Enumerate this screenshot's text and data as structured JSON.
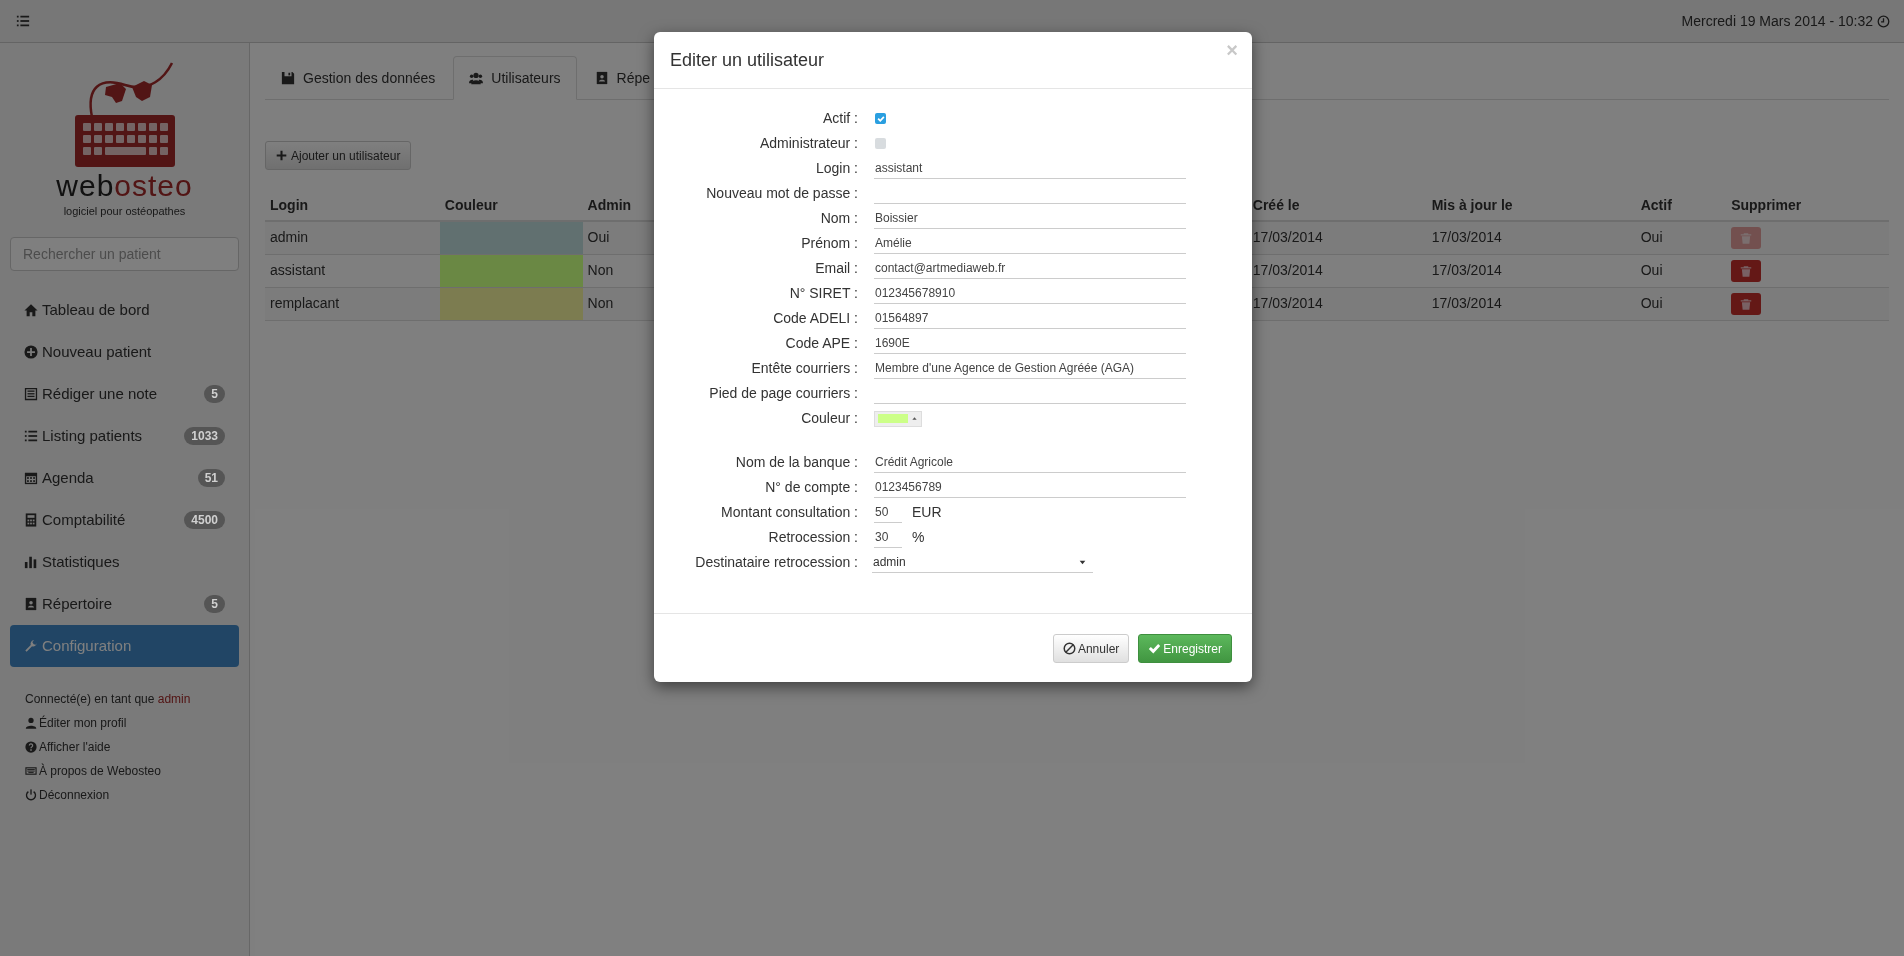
{
  "header": {
    "datetime": "Mercredi 19 Mars 2014 - 10:32"
  },
  "sidebar": {
    "brand": {
      "first": "web",
      "second": "osteo"
    },
    "tagline": "logiciel pour ostéopathes",
    "search": {
      "placeholder": "Rechercher un patient"
    },
    "items": [
      {
        "label": "Tableau de bord",
        "selected": false
      },
      {
        "label": "Nouveau patient",
        "selected": false
      },
      {
        "label": "Rédiger une note",
        "badge": "5",
        "selected": false
      },
      {
        "label": "Listing patients",
        "badge": "1033",
        "selected": false
      },
      {
        "label": "Agenda",
        "badge": "51",
        "selected": false
      },
      {
        "label": "Comptabilité",
        "badge": "4500",
        "selected": false
      },
      {
        "label": "Statistiques",
        "selected": false
      },
      {
        "label": "Répertoire",
        "badge": "5",
        "selected": false
      },
      {
        "label": "Configuration",
        "selected": true
      }
    ],
    "footer": {
      "connected_text": "Connecté(e) en tant que",
      "user": "admin",
      "links": [
        "Éditer mon profil",
        "Afficher l'aide",
        "À propos de Webosteo",
        "Déconnexion"
      ]
    }
  },
  "tabs": [
    {
      "label": "Gestion des données",
      "selected": false
    },
    {
      "label": "Utilisateurs",
      "selected": true
    },
    {
      "label": "Répe",
      "selected": false
    }
  ],
  "add_button": "Ajouter un utilisateur",
  "table": {
    "columns": [
      "Login",
      "Couleur",
      "Admin",
      "Créé le",
      "Mis à jour le",
      "Actif",
      "Supprimer"
    ],
    "rows": [
      {
        "login": "admin",
        "color": "#617070",
        "admin": "Oui",
        "created": "17/03/2014",
        "updated": "17/03/2014",
        "active": "Oui",
        "delete_disabled": true
      },
      {
        "login": "assistant",
        "color": "#6a8844",
        "admin": "Non",
        "created": "17/03/2014",
        "updated": "17/03/2014",
        "active": "Oui",
        "delete_disabled": false
      },
      {
        "login": "remplacant",
        "color": "#7c7c50",
        "admin": "Non",
        "created": "17/03/2014",
        "updated": "17/03/2014",
        "active": "Oui",
        "delete_disabled": false
      }
    ]
  },
  "modal": {
    "title": "Editer un utilisateur",
    "close": "×",
    "sections": [
      [
        {
          "kind": "checkbox",
          "label": "Actif :",
          "checked": true
        },
        {
          "kind": "checkbox",
          "label": "Administrateur :",
          "checked": false
        },
        {
          "kind": "text",
          "label": "Login :",
          "value": "assistant"
        },
        {
          "kind": "text",
          "label": "Nouveau mot de passe :"
        },
        {
          "kind": "text",
          "label": "Nom :",
          "value": "Boissier"
        },
        {
          "kind": "text",
          "label": "Prénom :",
          "value": "Amélie"
        },
        {
          "kind": "text",
          "label": "Email :",
          "value": "contact@artmediaweb.fr"
        },
        {
          "kind": "text",
          "label": "N° SIRET :",
          "value": "012345678910"
        },
        {
          "kind": "text",
          "label": "Code ADELI :",
          "value": "01564897"
        },
        {
          "kind": "text",
          "label": "Code APE :",
          "value": "1690E"
        },
        {
          "kind": "text",
          "label": "Entête courriers :",
          "value": "Membre d'une Agence de Gestion Agréée (AGA)"
        },
        {
          "kind": "text",
          "label": "Pied de page courriers :"
        },
        {
          "kind": "color",
          "label": "Couleur :",
          "color": "#ccff88"
        }
      ],
      [
        {
          "kind": "text",
          "label": "Nom de la banque :",
          "value": "Crédit Agricole"
        },
        {
          "kind": "text",
          "label": "N° de compte :",
          "value": "0123456789"
        },
        {
          "kind": "number",
          "label": "Montant consultation :",
          "value": "50",
          "unit": "EUR"
        },
        {
          "kind": "number",
          "label": "Retrocession :",
          "value": "30",
          "unit": "%"
        },
        {
          "kind": "select",
          "label": "Destinataire retrocession :",
          "value": "admin"
        }
      ]
    ],
    "buttons": [
      {
        "kind": "cancel",
        "label": "Annuler"
      },
      {
        "kind": "primary",
        "label": "Enregistrer"
      }
    ]
  }
}
